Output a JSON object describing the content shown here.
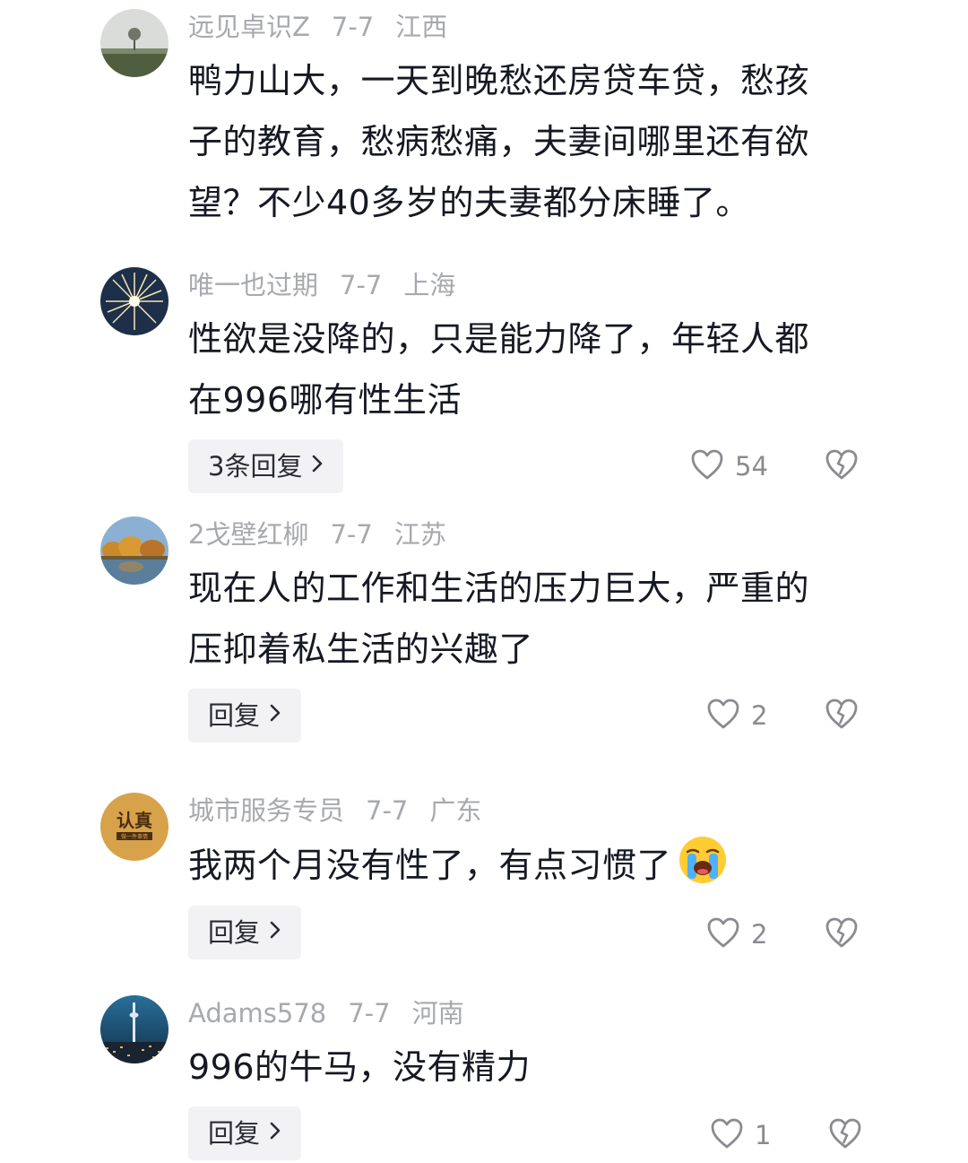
{
  "comments": [
    {
      "username": "远见卓识Z",
      "date": "7-7",
      "location": "江西",
      "lines": [
        "鸭力山大，一天到晚愁还房贷车贷，愁孩",
        "子的教育，愁病愁痛，夫妻间哪里还有欲",
        "望？不少40多岁的夫妻都分床睡了。"
      ],
      "avatar_icon": "tree-field-avatar"
    },
    {
      "username": "唯一也过期",
      "date": "7-7",
      "location": "上海",
      "lines": [
        "性欲是没降的，只是能力降了，年轻人都",
        "在996哪有性生活"
      ],
      "reply_label": "3条回复",
      "likes": "54",
      "avatar_icon": "sparkler-avatar"
    },
    {
      "username": "2戈壁红柳",
      "date": "7-7",
      "location": "江苏",
      "lines": [
        "现在人的工作和生活的压力巨大，严重的",
        "压抑着私生活的兴趣了"
      ],
      "reply_label": "回复",
      "likes": "2",
      "avatar_icon": "autumn-trees-avatar"
    },
    {
      "username": "城市服务专员",
      "date": "7-7",
      "location": "广东",
      "lines": [
        "我两个月没有性了，有点习惯了"
      ],
      "emoji": "crying-face-emoji",
      "reply_label": "回复",
      "likes": "2",
      "avatar_text": "认真",
      "avatar_subtext": "做一件事情",
      "avatar_icon": "text-badge-avatar"
    },
    {
      "username": "Adams578",
      "date": "7-7",
      "location": "河南",
      "lines": [
        "996的牛马，没有精力"
      ],
      "reply_label": "回复",
      "likes": "1",
      "avatar_icon": "tower-city-avatar"
    }
  ],
  "icons": {
    "like": "heart-outline-icon",
    "dislike": "broken-heart-icon",
    "chevron": "chevron-right-icon"
  },
  "colors": {
    "meta_text": "#a7a9ae",
    "body_text": "#161823",
    "reply_bg": "#f2f2f4",
    "count_text": "#8a8b91"
  }
}
